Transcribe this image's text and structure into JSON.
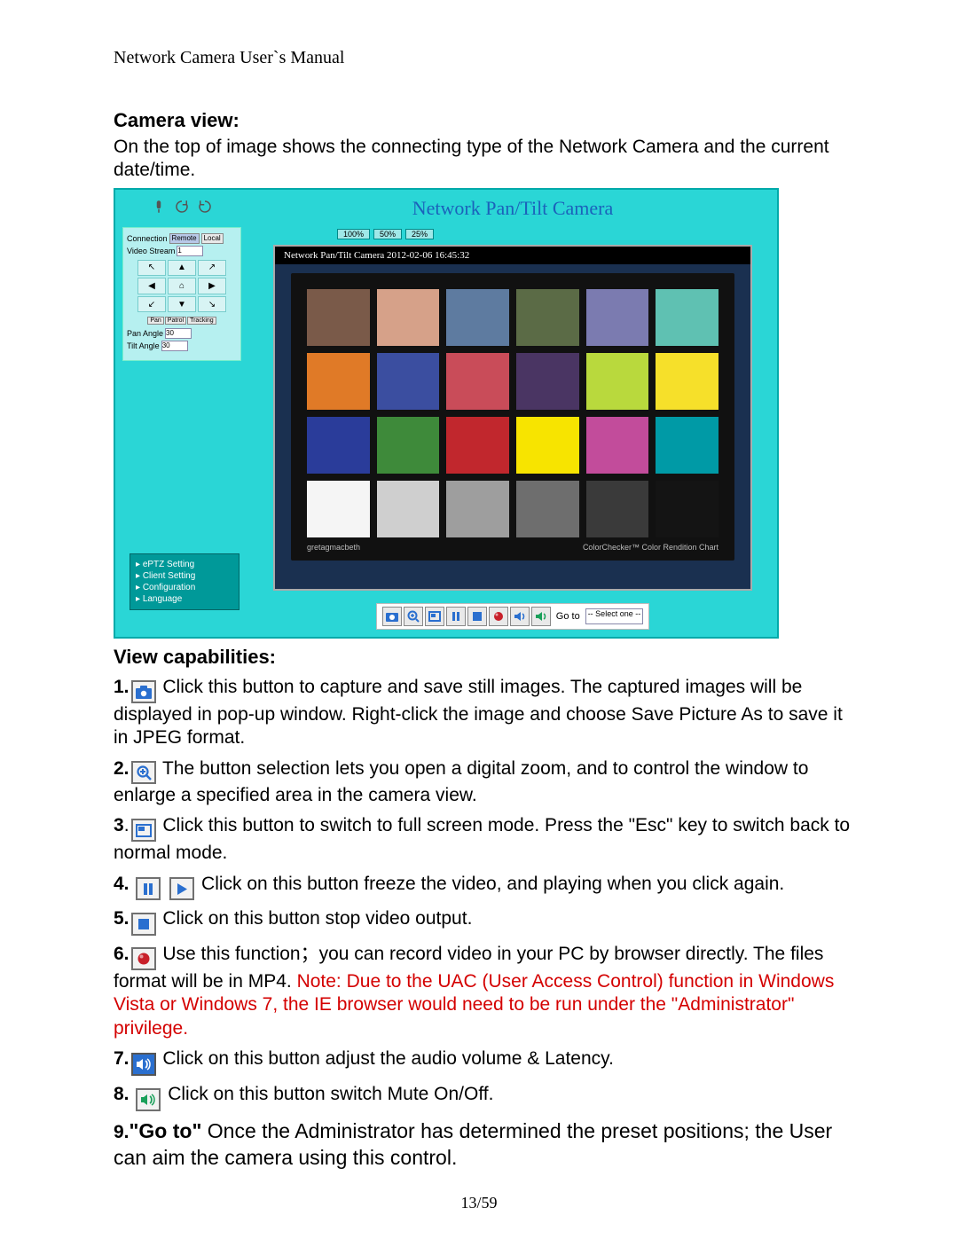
{
  "header": {
    "running": "Network Camera User`s Manual"
  },
  "footer": {
    "page": "13/59"
  },
  "section1": {
    "title": "Camera view:",
    "desc": "On the top of image shows the connecting type of the Network Camera and the current date/time."
  },
  "shot": {
    "title": "Network Pan/Tilt Camera",
    "panel": {
      "conn_label": "Connection",
      "remote": "Remote",
      "local": "Local",
      "vs_label": "Video Stream",
      "vs_value": "1",
      "pan_btn": "Pan",
      "patrol_btn": "Patrol",
      "track_btn": "Tracking",
      "pan_angle_label": "Pan Angle",
      "pan_angle_val": "30",
      "tilt_angle_label": "Tilt Angle",
      "tilt_angle_val": "30"
    },
    "links": {
      "eptz": "ePTZ Setting",
      "client": "Client Setting",
      "config": "Configuration",
      "lang": "Language"
    },
    "zoom": {
      "z100": "100%",
      "z50": "50%",
      "z25": "25%"
    },
    "video_header": "Network Pan/Tilt Camera 2012-02-06 16:45:32",
    "checker_brand": "gretagmacbeth",
    "checker_name": "ColorChecker™ Color Rendition Chart",
    "checker_colors": [
      "#7a5a49",
      "#d6a189",
      "#5e7ba0",
      "#5b6b46",
      "#7b7bb0",
      "#5fc1b2",
      "#e07a27",
      "#3b4ea0",
      "#c94c59",
      "#4a3563",
      "#b9d93d",
      "#f6e02a",
      "#2a3c9a",
      "#3e8a3a",
      "#c1272d",
      "#f7e400",
      "#c24c9b",
      "#009aa6",
      "#f5f5f5",
      "#cfcfcf",
      "#9e9e9e",
      "#6e6e6e",
      "#3a3a3a",
      "#141414"
    ],
    "goto_label": "Go to",
    "goto_value": "-- Select one --"
  },
  "section2": {
    "title": "View capabilities:"
  },
  "items": {
    "i1": {
      "n": "1.",
      "text": "Click this button to capture and save still images. The captured images will be displayed in pop-up window. Right-click the image and choose Save Picture As to save it in JPEG format."
    },
    "i2": {
      "n": "2.",
      "text": "The button selection lets you open a digital zoom, and to control the window to enlarge a specified area in the camera view."
    },
    "i3": {
      "n": "3",
      "text": "Click this button to switch to full screen mode. Press the \"Esc\" key to switch back to normal mode."
    },
    "i4": {
      "n": "4.",
      "text": "Click on this button freeze the video, and playing when you click again."
    },
    "i5": {
      "n": "5.",
      "text": "Click on this button stop video output."
    },
    "i6": {
      "n": "6.",
      "text_a": "Use this function；you can record video in your PC by browser directly. The files format will be in MP4. ",
      "text_b": "Note: Due to the UAC (User Access Control) function in Windows Vista or Windows 7, the IE browser would need to be run under the \"Administrator\" privilege."
    },
    "i7": {
      "n": "7.",
      "text": "Click on this button adjust the audio volume & Latency."
    },
    "i8": {
      "n": "8.",
      "text": "Click on this button switch Mute On/Off."
    },
    "i9": {
      "n": "9.",
      "goto": "\"Go to\"",
      "text": " Once the Administrator has determined the preset positions; the User can aim the camera using this control."
    }
  }
}
